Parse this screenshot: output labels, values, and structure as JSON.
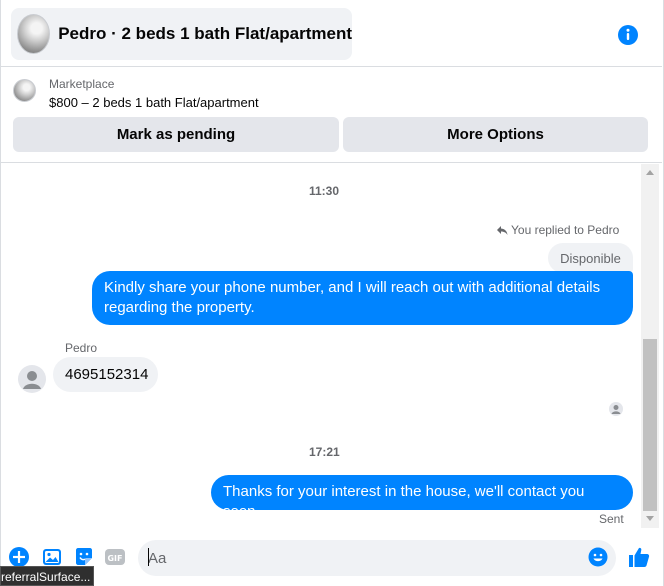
{
  "header": {
    "title": "Pedro · 2 beds 1 bath Flat/apartment",
    "info_icon": "info-icon"
  },
  "marketplace": {
    "label": "Marketplace",
    "listing": "$800 – 2 beds 1 bath Flat/apartment",
    "mark_pending_label": "Mark as pending",
    "more_options_label": "More Options"
  },
  "chat": {
    "timestamp_1": "11:30",
    "replied_label": "You replied to Pedro",
    "reply_quote": "Disponible",
    "outgoing_1": "Kindly share your phone number, and I will reach out with additional details regarding the property.",
    "sender_name": "Pedro",
    "incoming_1": "4695152314",
    "timestamp_2": "17:21",
    "outgoing_2": "Thanks for your interest in the house, we'll contact you soon",
    "sent_status": "Sent"
  },
  "composer": {
    "placeholder": "Aa",
    "value": "",
    "icons": [
      "plus-circle-icon",
      "photo-icon",
      "sticker-icon",
      "gif-icon",
      "emoji-icon",
      "thumbs-up-icon"
    ]
  },
  "tooltip": {
    "text": "referralSurface..."
  },
  "colors": {
    "accent": "#0084ff",
    "bubble_gray": "#f0f2f5",
    "button_gray": "#e4e6eb",
    "secondary_text": "#65676b"
  }
}
